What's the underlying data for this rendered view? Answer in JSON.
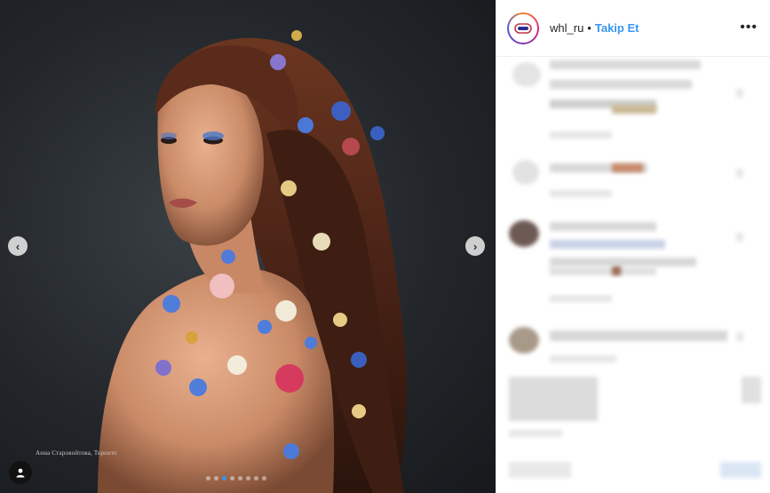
{
  "post": {
    "account": "whl_ru",
    "separator": "•",
    "follow_label": "Takip Et",
    "more_label": "•••",
    "caption": "Анна Старовойтова, Торонто"
  },
  "carousel": {
    "slide_count": 8,
    "active_index": 2
  },
  "colors": {
    "accent": "#3897f0"
  }
}
